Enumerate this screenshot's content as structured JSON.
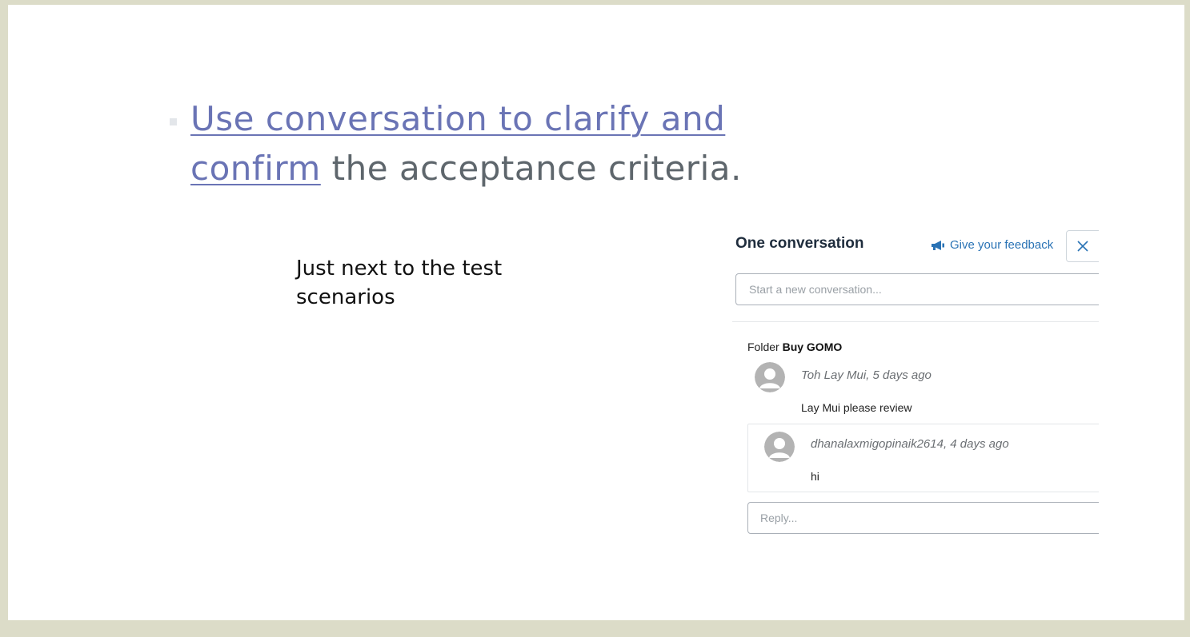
{
  "slide": {
    "bullet_link_text": "Use conversation to clarify and confirm",
    "bullet_rest_text": " the acceptance criteria.",
    "note_text": "Just next to the test scenarios"
  },
  "panel": {
    "title": "One conversation",
    "feedback_label": "Give your feedback",
    "new_conversation_placeholder": "Start a new conversation...",
    "folder_prefix": "Folder",
    "folder_name": "Buy GOMO",
    "comment": {
      "meta": "Toh Lay Mui, 5 days ago",
      "body": "Lay Mui please review"
    },
    "reply": {
      "meta": "dhanalaxmigopinaik2614, 4 days ago",
      "body": "hi"
    },
    "reply_placeholder": "Reply..."
  },
  "colors": {
    "link": "#6a74b5",
    "body_text": "#5e666c",
    "accent_blue": "#2a73b5",
    "frame": "#dcdcc8"
  },
  "icons": [
    "megaphone-icon",
    "close-icon",
    "user-avatar-icon"
  ]
}
